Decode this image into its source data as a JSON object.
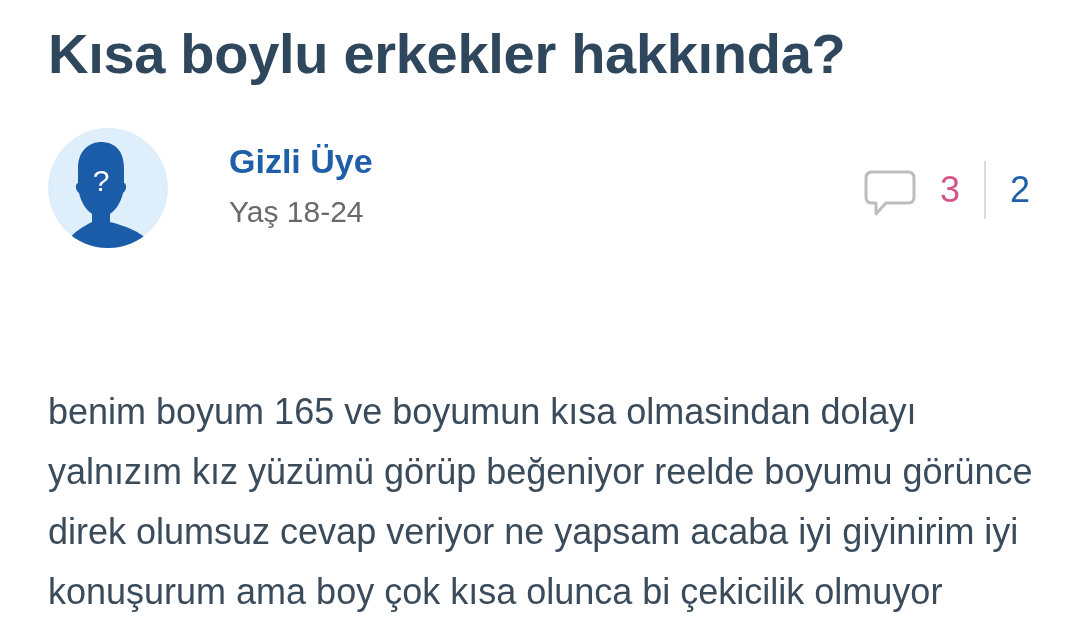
{
  "question": {
    "title": "Kısa boylu erkekler hakkında?"
  },
  "author": {
    "name": "Gizli Üye",
    "age": "Yaş 18-24",
    "avatar_mark": "?"
  },
  "counts": [
    {
      "value": "3",
      "color": "#d4558c"
    },
    {
      "value": "2",
      "color": "#1f5ea8"
    }
  ],
  "body": "benim boyum 165 ve boyumun kısa olmasindan dolayı yalnızım kız yüzümü görüp beğeniyor reelde boyumu görünce direk olumsuz cevap veriyor ne yapsam acaba iyi giyinirim iyi konuşurum ama boy çok kısa olunca bi çekicilik olmuyor"
}
